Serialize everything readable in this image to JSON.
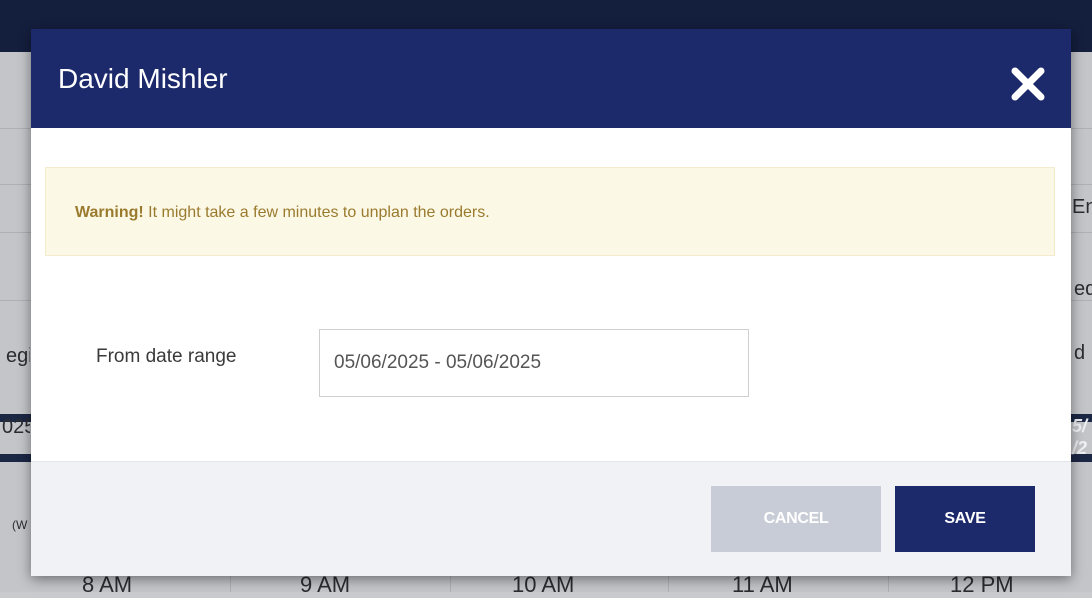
{
  "background": {
    "column_fragments": [
      "En",
      "eq",
      "d",
      "egi",
      "025",
      "5/",
      "/2",
      "(W"
    ],
    "time_labels": [
      "8 AM",
      "9 AM",
      "10 AM",
      "11 AM",
      "12 PM"
    ]
  },
  "modal": {
    "title": "David Mishler",
    "close_icon": "close-icon",
    "warning": {
      "strong": "Warning!",
      "message": " It might take a few minutes to unplan the orders."
    },
    "form": {
      "date_range_label": "From date range",
      "date_range_value": "05/06/2025 - 05/06/2025"
    },
    "footer": {
      "cancel_label": "CANCEL",
      "save_label": "SAVE"
    }
  },
  "colors": {
    "header": "#1c2a6b",
    "save_button": "#1c2a6b",
    "cancel_button_disabled": "#c8ccd6",
    "warning_bg": "#fcf8e6",
    "warning_text": "#9a7b2e"
  }
}
